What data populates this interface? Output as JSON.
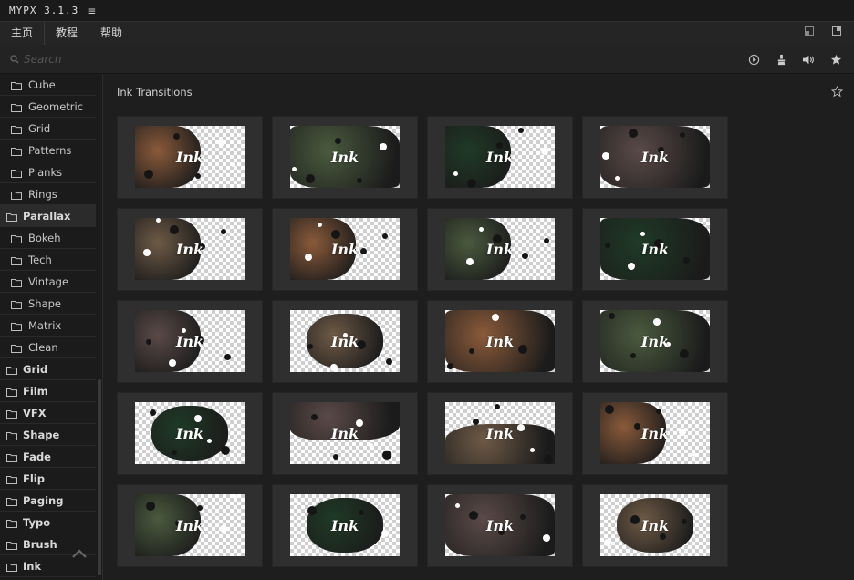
{
  "app": {
    "title": "MYPX 3.1.3"
  },
  "nav": {
    "items": [
      "主页",
      "教程",
      "帮助"
    ]
  },
  "search": {
    "placeholder": "Search"
  },
  "sidebar": {
    "items": [
      {
        "label": "Cube",
        "level": "sub"
      },
      {
        "label": "Geometric",
        "level": "sub"
      },
      {
        "label": "Grid",
        "level": "sub"
      },
      {
        "label": "Patterns",
        "level": "sub"
      },
      {
        "label": "Planks",
        "level": "sub"
      },
      {
        "label": "Rings",
        "level": "sub"
      },
      {
        "label": "Parallax",
        "level": "top",
        "active": true
      },
      {
        "label": "Bokeh",
        "level": "sub"
      },
      {
        "label": "Tech",
        "level": "sub"
      },
      {
        "label": "Vintage",
        "level": "sub"
      },
      {
        "label": "Shape",
        "level": "sub"
      },
      {
        "label": "Matrix",
        "level": "sub"
      },
      {
        "label": "Clean",
        "level": "sub"
      },
      {
        "label": "Grid",
        "level": "top"
      },
      {
        "label": "Film",
        "level": "top"
      },
      {
        "label": "VFX",
        "level": "top"
      },
      {
        "label": "Shape",
        "level": "top"
      },
      {
        "label": "Fade",
        "level": "top"
      },
      {
        "label": "Flip",
        "level": "top"
      },
      {
        "label": "Paging",
        "level": "top"
      },
      {
        "label": "Typo",
        "level": "top"
      },
      {
        "label": "Brush",
        "level": "top"
      },
      {
        "label": "Ink",
        "level": "top"
      }
    ]
  },
  "main": {
    "section_title": "Ink Transitions",
    "thumb_title": "Ink",
    "thumbnails": [
      {
        "photo": "camera",
        "side": "left"
      },
      {
        "photo": "couple",
        "side": "full"
      },
      {
        "photo": "forest",
        "side": "left"
      },
      {
        "photo": "hands",
        "side": "full"
      },
      {
        "photo": "camera2",
        "side": "left"
      },
      {
        "photo": "camera",
        "side": "left"
      },
      {
        "photo": "couple",
        "side": "left"
      },
      {
        "photo": "forest",
        "side": "full"
      },
      {
        "photo": "hands",
        "side": "left"
      },
      {
        "photo": "camera2",
        "side": "center"
      },
      {
        "photo": "camera",
        "side": "full"
      },
      {
        "photo": "couple",
        "side": "full"
      },
      {
        "photo": "forest",
        "side": "center"
      },
      {
        "photo": "hands",
        "side": "top"
      },
      {
        "photo": "camera2",
        "side": "bottom"
      },
      {
        "photo": "camera",
        "side": "left"
      },
      {
        "photo": "couple",
        "side": "left"
      },
      {
        "photo": "forest",
        "side": "center"
      },
      {
        "photo": "hands",
        "side": "full"
      },
      {
        "photo": "camera2",
        "side": "center"
      }
    ]
  },
  "colors": {
    "camera": "#8a5a3a",
    "couple": "#4a5a3e",
    "forest": "#1f3a26",
    "hands": "#5a4a48",
    "camera2": "#6e5a46"
  }
}
